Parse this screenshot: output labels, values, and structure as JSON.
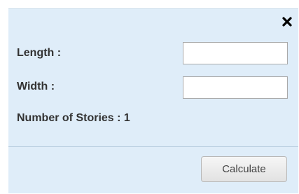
{
  "dialog": {
    "close_icon": "close-icon",
    "fields": {
      "length_label": "Length :",
      "length_value": "",
      "width_label": "Width :",
      "width_value": ""
    },
    "stories_text": "Number of Stories : 1",
    "calculate_label": "Calculate"
  },
  "colors": {
    "dialog_background": "#dfedf9",
    "divider": "#b5cbdd",
    "input_border": "#a9a9a9"
  }
}
